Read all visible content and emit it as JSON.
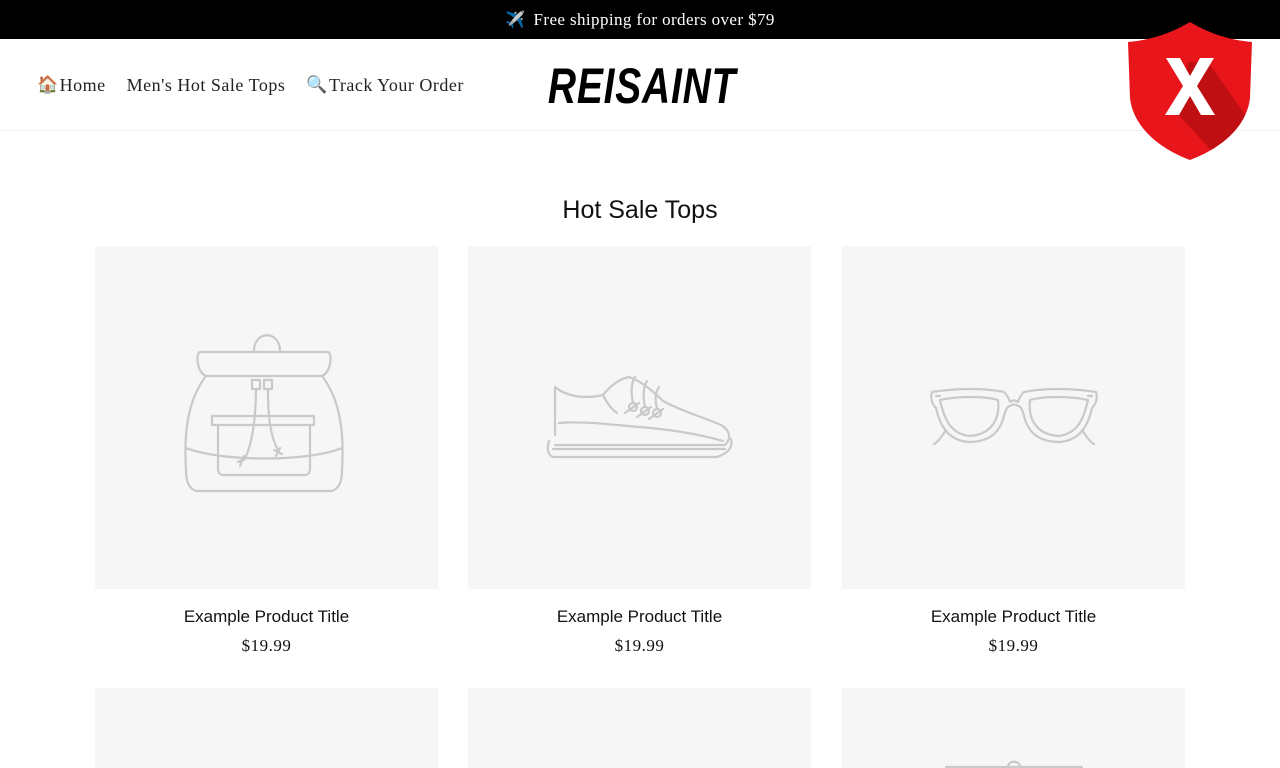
{
  "announcement": {
    "icon": "airplane-icon",
    "text": "Free shipping for orders over $79"
  },
  "nav": {
    "items": [
      {
        "icon": "house-icon",
        "label": "Home"
      },
      {
        "label": "Men's Hot Sale Tops"
      },
      {
        "icon": "magnifier-icon",
        "label": "Track Your Order"
      }
    ]
  },
  "brand": {
    "logo": "REISAINT"
  },
  "overlay": {
    "icon": "red-shield-x-icon",
    "color": "#e8151b"
  },
  "section": {
    "title": "Hot Sale Tops"
  },
  "products": [
    {
      "icon": "backpack-icon",
      "title": "Example Product Title",
      "price": "$19.99"
    },
    {
      "icon": "sneaker-icon",
      "title": "Example Product Title",
      "price": "$19.99"
    },
    {
      "icon": "sunglasses-icon",
      "title": "Example Product Title",
      "price": "$19.99"
    }
  ],
  "colors": {
    "announcement_bg": "#000000",
    "card_bg": "#f6f6f6",
    "placeholder_stroke": "#c9c9c9"
  }
}
